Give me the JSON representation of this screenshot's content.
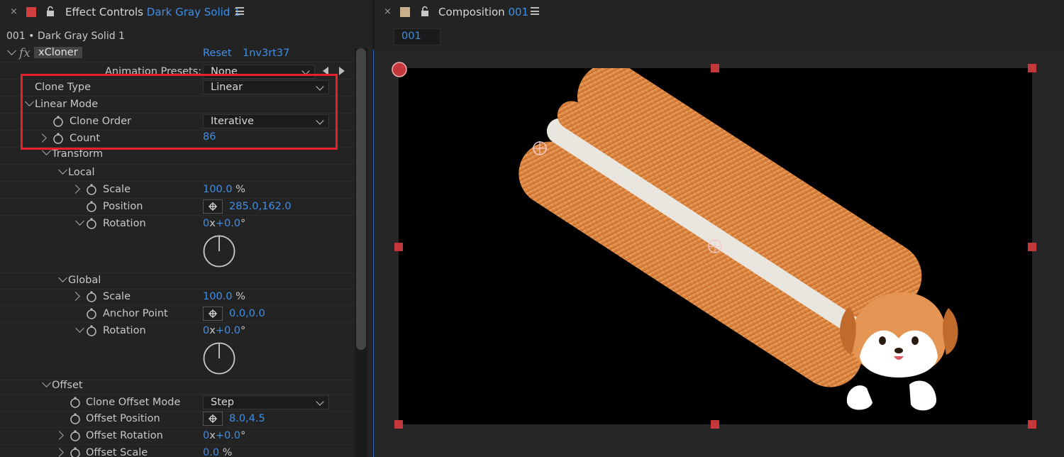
{
  "left_panel": {
    "close": "×",
    "title": "Effect Controls",
    "layer_link": "Dark Gray Solid 1",
    "layer_name": "001 • Dark Gray Solid 1",
    "effect_name": "xCloner",
    "reset": "Reset",
    "version": "1nv3rt37",
    "swatch_color": "#d0403e",
    "rows": {
      "animation_presets": {
        "label": "Animation Presets:",
        "value": "None"
      },
      "clone_type": {
        "label": "Clone Type",
        "value": "Linear"
      },
      "linear_mode": {
        "label": "Linear Mode"
      },
      "clone_order": {
        "label": "Clone Order",
        "value": "Iterative"
      },
      "count": {
        "label": "Count",
        "value": "86"
      },
      "transform": {
        "label": "Transform"
      },
      "local": {
        "label": "Local"
      },
      "local_scale": {
        "label": "Scale",
        "value": "100.0",
        "unit": "%"
      },
      "local_position": {
        "label": "Position",
        "x": "285.0",
        "y": "162.0"
      },
      "local_rotation": {
        "label": "Rotation",
        "turns": "0",
        "deg": "+0.0",
        "unit": "°"
      },
      "global": {
        "label": "Global"
      },
      "global_scale": {
        "label": "Scale",
        "value": "100.0",
        "unit": "%"
      },
      "anchor_point": {
        "label": "Anchor Point",
        "x": "0.0",
        "y": "0.0"
      },
      "global_rotation": {
        "label": "Rotation",
        "turns": "0",
        "deg": "+0.0",
        "unit": "°"
      },
      "offset": {
        "label": "Offset"
      },
      "clone_offset_mode": {
        "label": "Clone Offset Mode",
        "value": "Step"
      },
      "offset_position": {
        "label": "Offset Position",
        "x": "8.0",
        "y": "4.5"
      },
      "offset_rotation": {
        "label": "Offset Rotation",
        "turns": "0",
        "deg": "+0.0",
        "unit": "°"
      },
      "offset_scale": {
        "label": "Offset Scale",
        "value": "0.0",
        "unit": "%"
      }
    }
  },
  "right_panel": {
    "close": "×",
    "title": "Composition",
    "comp_link": "001",
    "breadcrumb": "001",
    "swatch_color": "#c8b08c"
  },
  "colors": {
    "accent_blue": "#3f8fe6",
    "highlight_red": "#e5222b",
    "handle_red": "#c4373b",
    "bread_orange": "#e08a45"
  }
}
